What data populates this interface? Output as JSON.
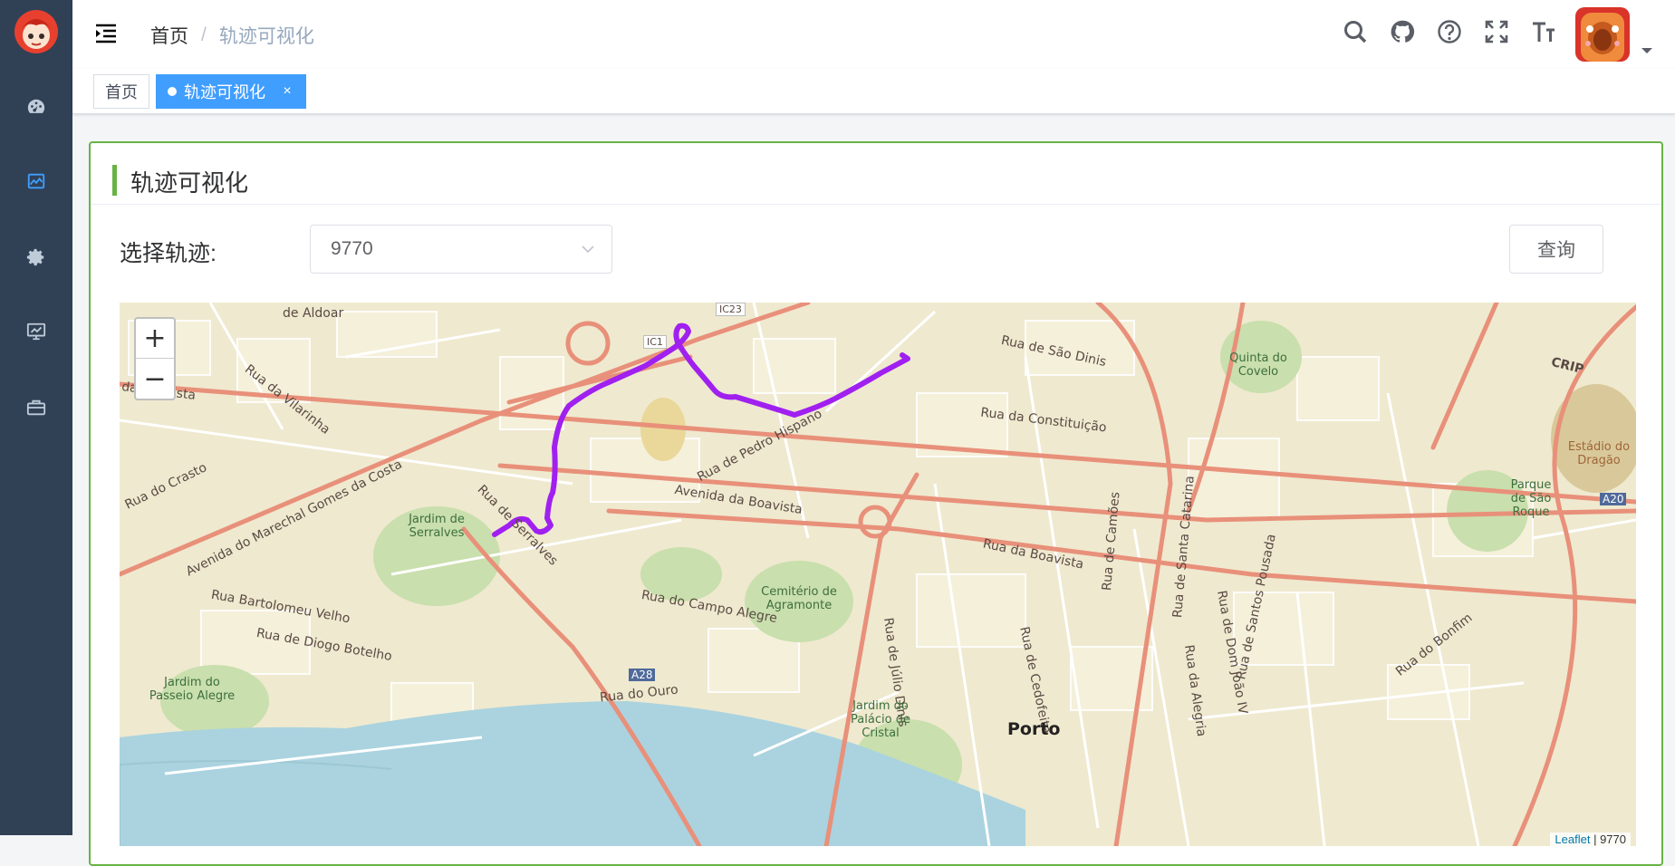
{
  "sidebar": {
    "items": [
      {
        "name": "dashboard",
        "active": false
      },
      {
        "name": "chart",
        "active": true
      },
      {
        "name": "settings",
        "active": false
      },
      {
        "name": "monitor",
        "active": false
      },
      {
        "name": "toolbox",
        "active": false
      }
    ]
  },
  "breadcrumb": {
    "home": "首页",
    "separator": "/",
    "current": "轨迹可视化"
  },
  "tags": {
    "home": "首页",
    "active": "轨迹可视化",
    "close": "×"
  },
  "card": {
    "title": "轨迹可视化"
  },
  "form": {
    "label": "选择轨迹:",
    "selected": "9770",
    "query_button": "查询"
  },
  "map": {
    "zoom_in": "+",
    "zoom_out": "−",
    "attribution_link": "Leaflet",
    "attribution_text": " | 9770",
    "track_color": "#a020f0",
    "labels": {
      "aldoar": "de Aldoar",
      "vilarinha": "Rua da Vilarinha",
      "boavista_w": "da Boavista",
      "crasto": "Rua do Crasto",
      "marechal": "Avenida do Marechal Gomes da Costa",
      "serralves_garden": "Jardim de Serralves",
      "serralves_rua": "Rua de Serralves",
      "bartolomeu": "Rua Bartolomeu Velho",
      "diogo": "Rua de Diogo Botelho",
      "passeio": "Jardim do Passeio Alegre",
      "ouro": "Rua do Ouro",
      "pedro_hispano": "Rua de Pedro Hispano",
      "boavista_av": "Avenida da Boavista",
      "cemiterio": "Cemitério de Agramonte",
      "campo_alegre": "Rua do Campo Alegre",
      "a28": "A28",
      "sao_dinis": "Rua de São Dinis",
      "constituicao": "Rua da Constituição",
      "quinta": "Quinta do Covelo",
      "rua_boavista": "Rua da Boavista",
      "julio_dinis": "Rua de Júlio Dinis",
      "cedofeita": "Rua de Cedofeita",
      "camoes": "Rua de Camões",
      "santa_catarina": "Rua de Santa Catarina",
      "dom_joao": "Rua de Dom João IV",
      "alegria": "Rua da Alegria",
      "santos_pousada": "Rua de Santos Pousada",
      "bonfim": "Rua do Bonfim",
      "porto": "Porto",
      "palacio": "Jardim do Palácio de Cristal",
      "estadio": "Estádio do Dragão",
      "parque_sao_roque": "Parque de São Roque",
      "crip": "CRIP",
      "a20": "A20",
      "ic23": "IC23",
      "ic1": "IC1"
    }
  }
}
